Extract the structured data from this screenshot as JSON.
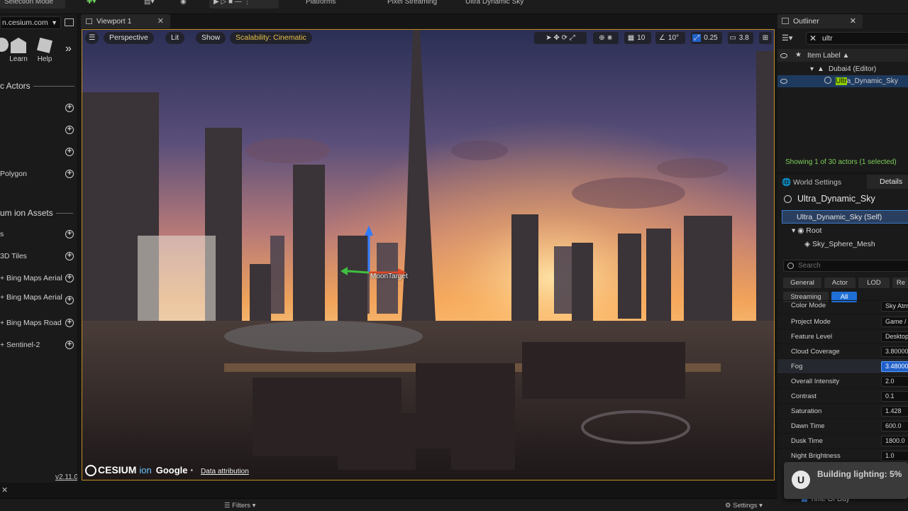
{
  "toolbar": {
    "selection_mode": "Selection Mode",
    "platforms": "Platforms",
    "pixel_streaming": "Pixel Streaming",
    "ultra_dynamic_sky": "Ultra Dynamic Sky"
  },
  "left_panel": {
    "url": "n.cesium.com",
    "quick_buttons": [
      {
        "label": "",
        "icon": "cesium-icon"
      },
      {
        "label": "Learn",
        "icon": "learn-icon"
      },
      {
        "label": "Help",
        "icon": "help-icon"
      }
    ],
    "section_basic": "c Actors",
    "basic_items": [
      "",
      "",
      "",
      "Polygon"
    ],
    "section_ion": "um ion Assets",
    "ion_items": [
      "s",
      "3D Tiles",
      "+ Bing Maps Aerial",
      "+ Bing Maps Aerial",
      "+ Bing Maps Road",
      "+ Sentinel-2"
    ],
    "version": "v2.11.0"
  },
  "viewport": {
    "tab": "Viewport 1",
    "perspective": "Perspective",
    "lit": "Lit",
    "show": "Show",
    "scalability": "Scalability: Cinematic",
    "grid_snap": "10",
    "rot_snap": "10°",
    "scale_snap": "0.25",
    "cam_speed": "3.8",
    "gizmo_label": "MoonTarget",
    "attribution": {
      "cesium": "CESIUM",
      "ion": "ion",
      "google": "Google",
      "data": "Data attribution"
    }
  },
  "outliner": {
    "tab": "Outliner",
    "search": "ultr",
    "header": "Item Label ▲",
    "rows": [
      {
        "label": "Dubai4 (Editor)",
        "highlight": "",
        "rest": ""
      },
      {
        "label": "",
        "highlight": "Ultr",
        "rest": "a_Dynamic_Sky"
      }
    ],
    "status": "Showing 1 of 30 actors (1 selected)"
  },
  "details": {
    "world_settings": "World Settings",
    "details_tab": "Details",
    "actor_name": "Ultra_Dynamic_Sky",
    "component_self": "Ultra_Dynamic_Sky (Self)",
    "root": "Root",
    "mesh": "Sky_Sphere_Mesh",
    "search_placeholder": "Search",
    "filter_tabs": [
      "General",
      "Actor",
      "LOD",
      "Re",
      "Streaming",
      "All"
    ],
    "properties": [
      {
        "label": "Color Mode",
        "value": "Sky Atm"
      },
      {
        "label": "Project Mode",
        "value": "Game /"
      },
      {
        "label": "Feature Level",
        "value": "Desktop"
      },
      {
        "label": "Cloud Coverage",
        "value": "3.800000"
      },
      {
        "label": "Fog",
        "value": "3.480000"
      },
      {
        "label": "Overall Intensity",
        "value": "2.0"
      },
      {
        "label": "Contrast",
        "value": "0.1"
      },
      {
        "label": "Saturation",
        "value": "1.428"
      },
      {
        "label": "Dawn Time",
        "value": "600.0"
      },
      {
        "label": "Dusk Time",
        "value": "1800.0"
      },
      {
        "label": "Night Brightness",
        "value": "1.0"
      }
    ],
    "time_of_day": "Time Of Day"
  },
  "toast": {
    "message": "Building lighting:",
    "percent": "5%"
  },
  "bottom": {
    "filters": "Filters",
    "settings": "Settings"
  }
}
